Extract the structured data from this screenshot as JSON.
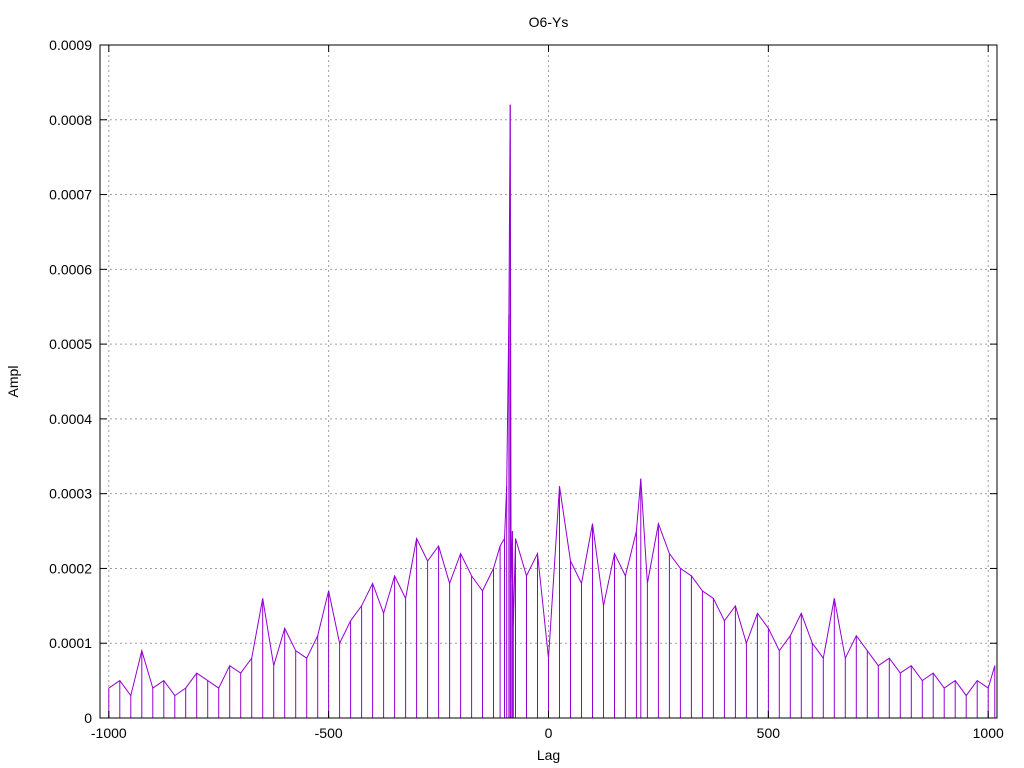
{
  "chart_data": {
    "type": "line",
    "title": "O6-Ys",
    "xlabel": "Lag",
    "ylabel": "Ampl",
    "xlim": [
      -1020,
      1020
    ],
    "ylim": [
      0,
      0.0009
    ],
    "xticks": [
      {
        "value": -1000,
        "label": "-1000"
      },
      {
        "value": -500,
        "label": "-500"
      },
      {
        "value": 0,
        "label": "0"
      },
      {
        "value": 500,
        "label": "500"
      },
      {
        "value": 1000,
        "label": "1000"
      }
    ],
    "yticks": [
      {
        "value": 0,
        "label": "0"
      },
      {
        "value": 0.0001,
        "label": "0.0001"
      },
      {
        "value": 0.0002,
        "label": "0.0002"
      },
      {
        "value": 0.0003,
        "label": "0.0003"
      },
      {
        "value": 0.0004,
        "label": "0.0004"
      },
      {
        "value": 0.0005,
        "label": "0.0005"
      },
      {
        "value": 0.0006,
        "label": "0.0006"
      },
      {
        "value": 0.0007,
        "label": "0.0007"
      },
      {
        "value": 0.0008,
        "label": "0.0008"
      },
      {
        "value": 0.0009,
        "label": "0.0009"
      }
    ],
    "grid": true,
    "series": [
      {
        "color": "#9400d3",
        "x": [
          -1000,
          -975,
          -950,
          -925,
          -900,
          -875,
          -850,
          -825,
          -800,
          -775,
          -750,
          -725,
          -700,
          -675,
          -650,
          -625,
          -600,
          -575,
          -550,
          -525,
          -500,
          -475,
          -450,
          -425,
          -400,
          -375,
          -350,
          -325,
          -300,
          -275,
          -250,
          -225,
          -200,
          -175,
          -150,
          -125,
          -110,
          -100,
          -95,
          -90,
          -87,
          -85,
          -82,
          -80,
          -75,
          -50,
          -25,
          0,
          25,
          50,
          75,
          100,
          125,
          150,
          175,
          200,
          210,
          225,
          250,
          275,
          300,
          325,
          350,
          375,
          400,
          425,
          450,
          475,
          500,
          525,
          550,
          575,
          600,
          625,
          650,
          675,
          700,
          725,
          750,
          775,
          800,
          825,
          850,
          875,
          900,
          925,
          950,
          975,
          1000,
          1015
        ],
        "y": [
          4e-05,
          5e-05,
          3e-05,
          9e-05,
          4e-05,
          5e-05,
          3e-05,
          4e-05,
          6e-05,
          5e-05,
          4e-05,
          7e-05,
          6e-05,
          8e-05,
          0.00016,
          7e-05,
          0.00012,
          9e-05,
          8e-05,
          0.00011,
          0.00017,
          0.0001,
          0.00013,
          0.00015,
          0.00018,
          0.00014,
          0.00019,
          0.00016,
          0.00024,
          0.00021,
          0.00023,
          0.00018,
          0.00022,
          0.00019,
          0.00017,
          0.0002,
          0.00023,
          0.00024,
          0.00031,
          0.00054,
          0.00082,
          0.00018,
          0.00025,
          0.00012,
          0.00024,
          0.00019,
          0.00022,
          8e-05,
          0.00031,
          0.00021,
          0.00018,
          0.00026,
          0.00015,
          0.00022,
          0.00019,
          0.00025,
          0.00032,
          0.00018,
          0.00026,
          0.00022,
          0.0002,
          0.00019,
          0.00017,
          0.00016,
          0.00013,
          0.00015,
          0.0001,
          0.00014,
          0.00012,
          9e-05,
          0.00011,
          0.00014,
          0.0001,
          8e-05,
          0.00016,
          8e-05,
          0.00011,
          9e-05,
          7e-05,
          8e-05,
          6e-05,
          7e-05,
          5e-05,
          6e-05,
          4e-05,
          5e-05,
          3e-05,
          5e-05,
          4e-05,
          7e-05
        ]
      }
    ]
  }
}
